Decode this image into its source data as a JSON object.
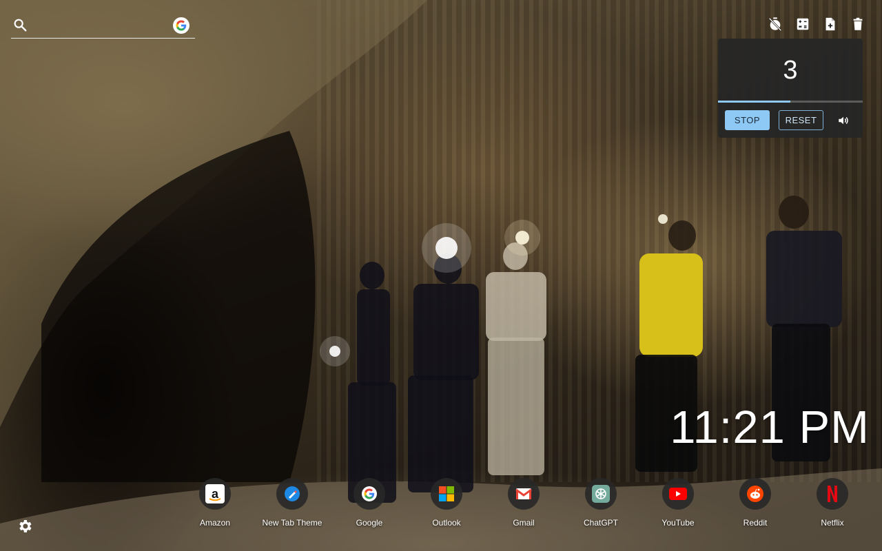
{
  "search": {
    "value": "",
    "icon": "search-icon",
    "engine_icon": "google-icon"
  },
  "toolbar": {
    "icons": [
      "timer-off-icon",
      "calculator-icon",
      "note-add-icon",
      "trash-icon"
    ]
  },
  "timer": {
    "count": "3",
    "progress": 0.5,
    "stop_label": "STOP",
    "reset_label": "RESET",
    "sound_icon": "volume-icon",
    "accent": "#8ec8f4"
  },
  "clock": {
    "time": "11:21 PM"
  },
  "shortcuts": [
    {
      "label": "Amazon",
      "icon": "amazon-icon"
    },
    {
      "label": "New Tab Theme",
      "icon": "new-tab-theme-icon"
    },
    {
      "label": "Google",
      "icon": "google-icon"
    },
    {
      "label": "Outlook",
      "icon": "outlook-icon"
    },
    {
      "label": "Gmail",
      "icon": "gmail-icon"
    },
    {
      "label": "ChatGPT",
      "icon": "chatgpt-icon"
    },
    {
      "label": "YouTube",
      "icon": "youtube-icon"
    },
    {
      "label": "Reddit",
      "icon": "reddit-icon"
    },
    {
      "label": "Netflix",
      "icon": "netflix-icon"
    }
  ],
  "settings": {
    "icon": "gear-icon"
  }
}
